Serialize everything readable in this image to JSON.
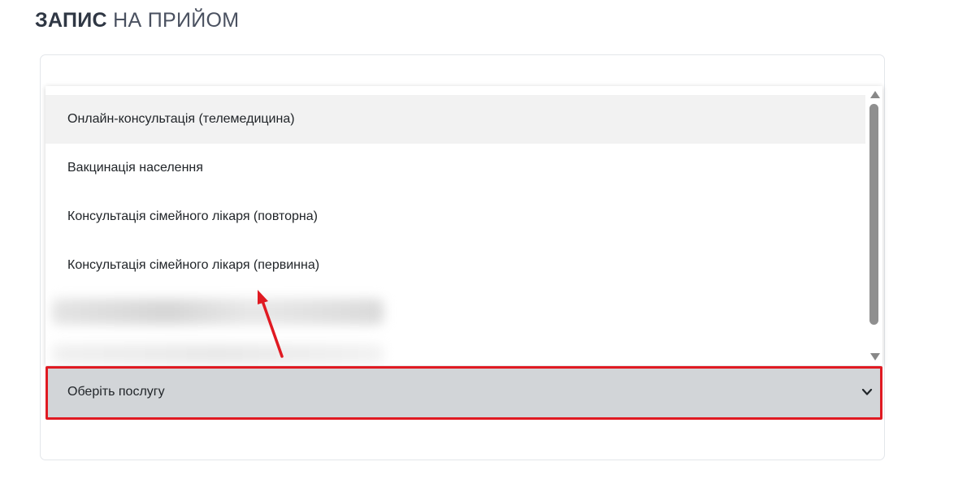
{
  "header": {
    "title_bold": "ЗАПИС",
    "title_rest": "НА ПРИЙОМ"
  },
  "service_select": {
    "value": "Оберіть послугу",
    "options": [
      {
        "label": "Онлайн-консультація (телемедицина)",
        "highlighted": true
      },
      {
        "label": "Вакцинація населення",
        "highlighted": false
      },
      {
        "label": "Консультація сімейного лікаря (повторна)",
        "highlighted": false
      },
      {
        "label": "Консультація сімейного лікаря (первинна)",
        "highlighted": false
      }
    ],
    "chevron_icon": "chevron-down-icon"
  },
  "scrollbar": {
    "up_icon": "triangle-up-icon",
    "down_icon": "triangle-down-icon"
  },
  "annotation": {
    "frame_color": "#e01a22",
    "arrow_color": "#e01a22",
    "arrow_icon": "arrow-up-icon"
  },
  "colors": {
    "title": "#2f3744",
    "select_background": "#d2d5d8",
    "option_highlight": "#f2f2f2",
    "scroll_thumb": "#8f8f8f"
  }
}
